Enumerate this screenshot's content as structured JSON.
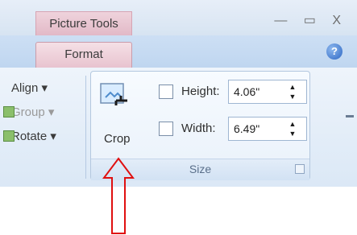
{
  "context_tab": "Picture Tools",
  "window_buttons": "— ▭ X",
  "tab": "Format",
  "help_symbol": "?",
  "left_group": {
    "align": "Align ▾",
    "group": "Group ▾",
    "rotate": "Rotate ▾"
  },
  "size_group": {
    "crop": "Crop",
    "height_label": "Height:",
    "height_value": "4.06\"",
    "width_label": "Width:",
    "width_value": "6.49\"",
    "footer": "Size"
  }
}
